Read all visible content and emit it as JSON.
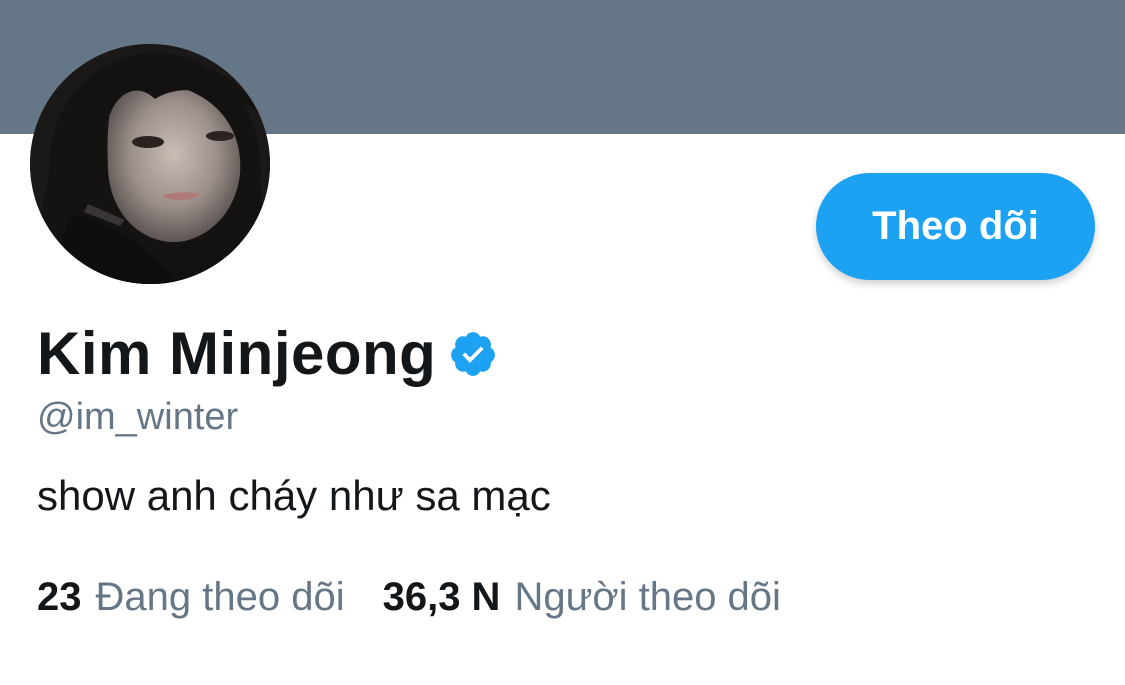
{
  "profile": {
    "display_name": "Kim Minjeong",
    "handle": "@im_winter",
    "bio": "show anh cháy như sa mạc",
    "verified": true
  },
  "actions": {
    "follow_label": "Theo dõi"
  },
  "stats": {
    "following_count": "23",
    "following_label": "Đang theo dõi",
    "followers_count": "36,3 N",
    "followers_label": "Người theo dõi"
  },
  "colors": {
    "banner": "#657786",
    "accent": "#1da1f2",
    "primary_text": "#14171a",
    "secondary_text": "#657786"
  },
  "icons": {
    "verified": "verified-badge-icon"
  }
}
